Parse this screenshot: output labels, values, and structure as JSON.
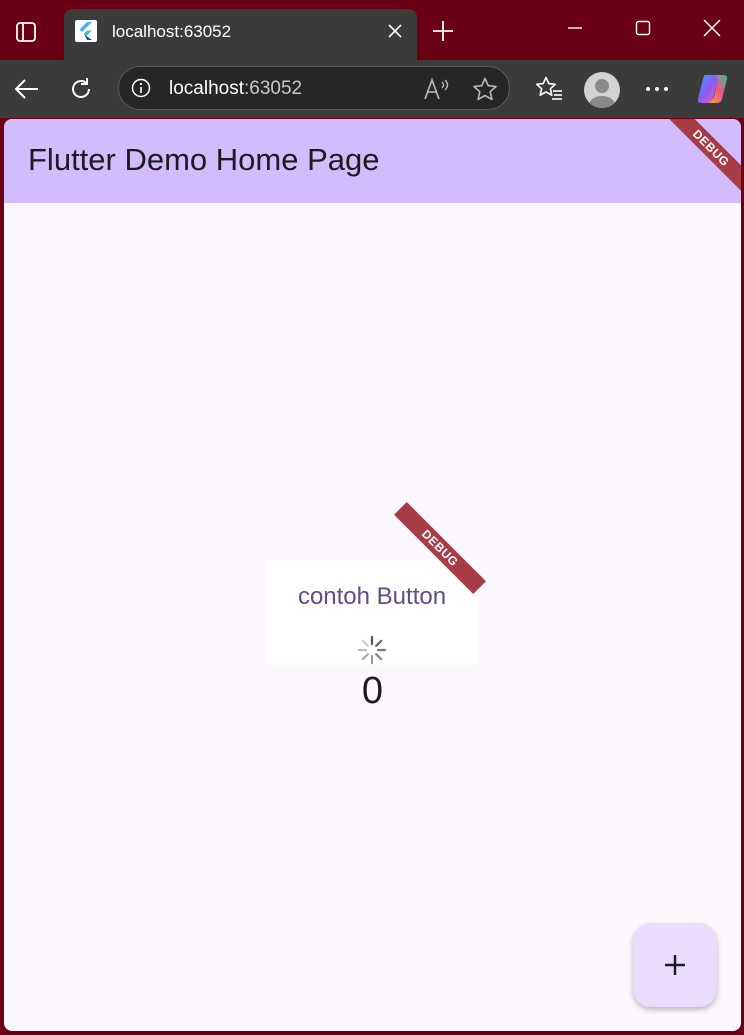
{
  "browser": {
    "tab_title": "localhost:63052",
    "url_host": "localhost",
    "url_port": ":63052",
    "icons": {
      "tab_actions": "tab-actions-icon",
      "favicon": "flutter-icon",
      "close": "close-icon",
      "new_tab": "plus-icon",
      "minimize": "minimize-icon",
      "maximize": "maximize-icon",
      "window_close": "close-icon",
      "back": "back-arrow-icon",
      "refresh": "refresh-icon",
      "site_info": "info-icon",
      "read_aloud": "read-aloud-icon",
      "favorite": "star-icon",
      "favorites": "favorites-list-icon",
      "profile": "avatar",
      "more": "more-icon",
      "copilot": "copilot-icon"
    },
    "colors": {
      "frame": "#6b0014",
      "toolbar": "#3b3b3b"
    }
  },
  "app": {
    "title": "Flutter Demo Home Page",
    "debug_label": "DEBUG",
    "button_label": "contoh Button",
    "counter": "0",
    "fab_icon": "plus-icon",
    "colors": {
      "appbar": "#d2bcfd",
      "background": "#fdf7fe",
      "debug_banner": "#a73c46",
      "fab": "#eadcfd",
      "button_text": "#5e4d8a"
    }
  }
}
